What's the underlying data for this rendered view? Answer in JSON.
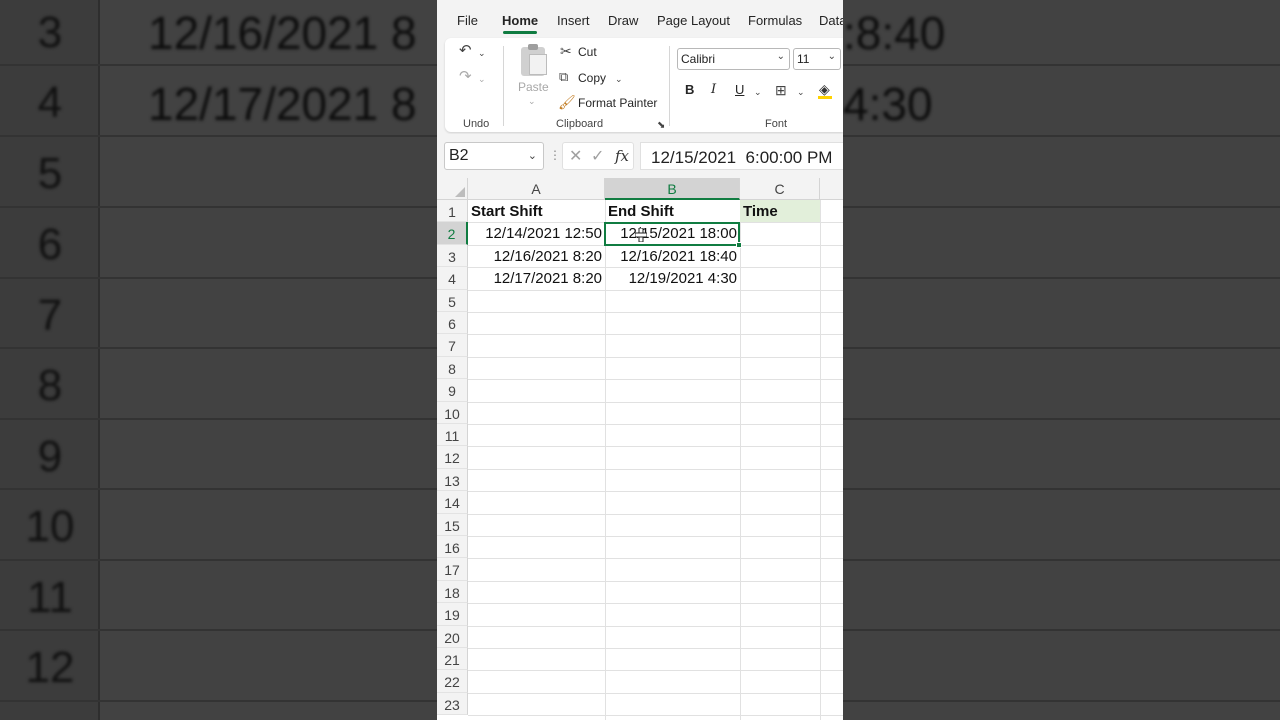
{
  "background": {
    "rows": [
      "3",
      "4",
      "5",
      "6",
      "7",
      "8",
      "9",
      "10",
      "11",
      "12"
    ],
    "cells": [
      "12/16/2021 8",
      "12/17/2021 8",
      ":8:40",
      "4:30"
    ]
  },
  "menu": {
    "tabs": [
      "File",
      "Home",
      "Insert",
      "Draw",
      "Page Layout",
      "Formulas",
      "Data"
    ],
    "active": "Home"
  },
  "ribbon": {
    "undo_group": "Undo",
    "paste_label": "Paste",
    "cut_label": "Cut",
    "copy_label": "Copy",
    "format_painter_label": "Format Painter",
    "clipboard_group": "Clipboard",
    "font_name": "Calibri",
    "font_size": "11",
    "bold": "B",
    "italic": "I",
    "underline": "U",
    "font_group": "Font"
  },
  "formula_bar": {
    "name_box": "B2",
    "fx": "fx",
    "formula": "12/15/2021  6:00:00 PM"
  },
  "grid": {
    "columns": [
      "A",
      "B",
      "C"
    ],
    "selected_column": "B",
    "selected_row": "2",
    "rows": [
      "1",
      "2",
      "3",
      "4",
      "5",
      "6",
      "7",
      "8",
      "9",
      "10",
      "11",
      "12",
      "13",
      "14",
      "15",
      "16",
      "17",
      "18",
      "19",
      "20",
      "21",
      "22",
      "23"
    ],
    "headers": [
      "Start Shift",
      "End Shift",
      "Time"
    ],
    "data": [
      [
        "12/14/2021 12:50",
        "12/15/2021 18:00"
      ],
      [
        "12/16/2021 8:20",
        "12/16/2021 18:40"
      ],
      [
        "12/17/2021 8:20",
        "12/19/2021 4:30"
      ]
    ]
  },
  "colors": {
    "accent": "#107c41",
    "header_fill": "#e2efda"
  }
}
